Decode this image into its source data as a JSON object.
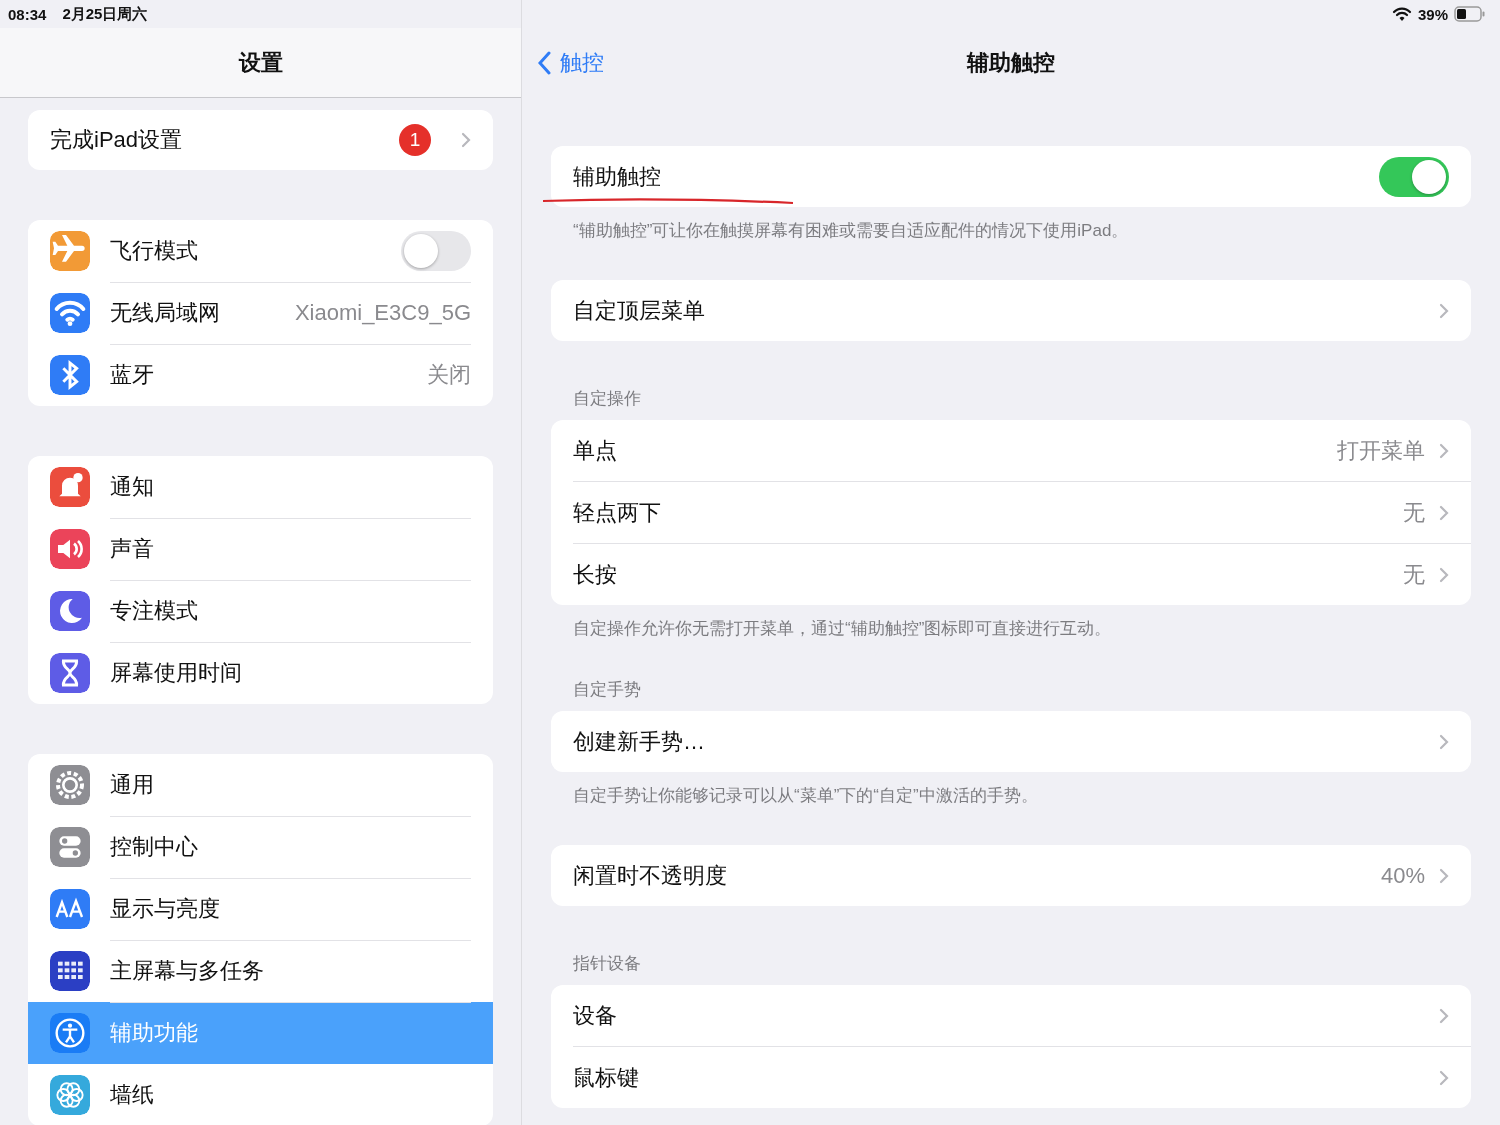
{
  "status_bar": {
    "time": "08:34",
    "date": "2月25日周六",
    "battery": "39%"
  },
  "sidebar": {
    "title": "设置",
    "groups": [
      {
        "items": [
          {
            "kind": "badge",
            "label": "完成iPad设置",
            "badge": "1",
            "selected": false
          }
        ]
      },
      {
        "items": [
          {
            "kind": "toggle",
            "label": "飞行模式",
            "on": false,
            "selected": false
          },
          {
            "kind": "value",
            "label": "无线局域网",
            "value": "Xiaomi_E3C9_5G",
            "selected": false
          },
          {
            "kind": "value",
            "label": "蓝牙",
            "value": "关闭",
            "selected": false
          }
        ]
      },
      {
        "items": [
          {
            "kind": "plain",
            "label": "通知",
            "selected": false
          },
          {
            "kind": "plain",
            "label": "声音",
            "selected": false
          },
          {
            "kind": "plain",
            "label": "专注模式",
            "selected": false
          },
          {
            "kind": "plain",
            "label": "屏幕使用时间",
            "selected": false
          }
        ]
      },
      {
        "items": [
          {
            "kind": "plain",
            "label": "通用",
            "selected": false
          },
          {
            "kind": "plain",
            "label": "控制中心",
            "selected": false
          },
          {
            "kind": "plain",
            "label": "显示与亮度",
            "selected": false
          },
          {
            "kind": "plain",
            "label": "主屏幕与多任务",
            "selected": false
          },
          {
            "kind": "plain",
            "label": "辅助功能",
            "selected": true
          },
          {
            "kind": "plain",
            "label": "墙纸",
            "selected": false
          }
        ]
      }
    ]
  },
  "detail": {
    "back": "触控",
    "title": "辅助触控",
    "sections": [
      {
        "rows": [
          {
            "kind": "toggle",
            "label": "辅助触控",
            "on": true
          }
        ],
        "footer": "“辅助触控”可让你在触摸屏幕有困难或需要自适应配件的情况下使用iPad。"
      },
      {
        "rows": [
          {
            "kind": "link",
            "label": "自定顶层菜单"
          }
        ]
      },
      {
        "header": "自定操作",
        "rows": [
          {
            "kind": "link",
            "label": "单点",
            "value": "打开菜单"
          },
          {
            "kind": "link",
            "label": "轻点两下",
            "value": "无"
          },
          {
            "kind": "link",
            "label": "长按",
            "value": "无"
          }
        ],
        "footer": "自定操作允许你无需打开菜单，通过“辅助触控”图标即可直接进行互动。"
      },
      {
        "header": "自定手势",
        "rows": [
          {
            "kind": "link",
            "label": "创建新手势…"
          }
        ],
        "footer": "自定手势让你能够记录可以从“菜单”下的“自定”中激活的手势。"
      },
      {
        "rows": [
          {
            "kind": "link",
            "label": "闲置时不透明度",
            "value": "40%"
          }
        ]
      },
      {
        "header": "指针设备",
        "rows": [
          {
            "kind": "link",
            "label": "设备"
          },
          {
            "kind": "link",
            "label": "鼠标键"
          }
        ]
      }
    ]
  }
}
